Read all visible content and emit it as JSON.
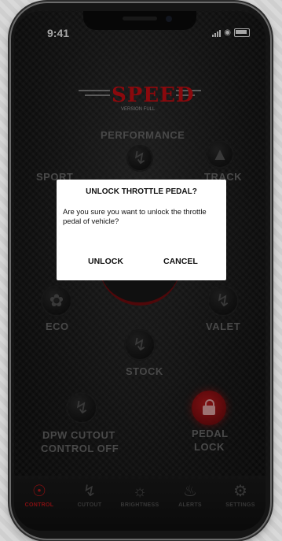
{
  "status": {
    "time": "9:41"
  },
  "logo": {
    "text": "SPEED",
    "sub": "VERSION FULL"
  },
  "modes": {
    "performance": "PERFORMANCE",
    "sport": "SPORT",
    "track": "TRACK",
    "eco": "ECO",
    "valet": "VALET",
    "stock": "STOCK",
    "dpw_cutout": "DPW CUTOUT",
    "control_off": "CONTROL OFF",
    "pedal": "PEDAL",
    "lock": "LOCK"
  },
  "dialog": {
    "title": "UNLOCK THROTTLE PEDAL?",
    "message": "Are you sure you want to unlock the throttle pedal of vehicle?",
    "confirm": "UNLOCK",
    "cancel": "CANCEL"
  },
  "tabs": [
    {
      "label": "CONTROL",
      "icon": "steering-wheel-icon"
    },
    {
      "label": "CUTOUT",
      "icon": "lightning-icon"
    },
    {
      "label": "BRIGHTNESS",
      "icon": "sun-icon"
    },
    {
      "label": "ALERTS",
      "icon": "bell-icon"
    },
    {
      "label": "SETTINGS",
      "icon": "gear-icon"
    }
  ],
  "colors": {
    "accent": "#c8181c",
    "background": "#161616"
  }
}
